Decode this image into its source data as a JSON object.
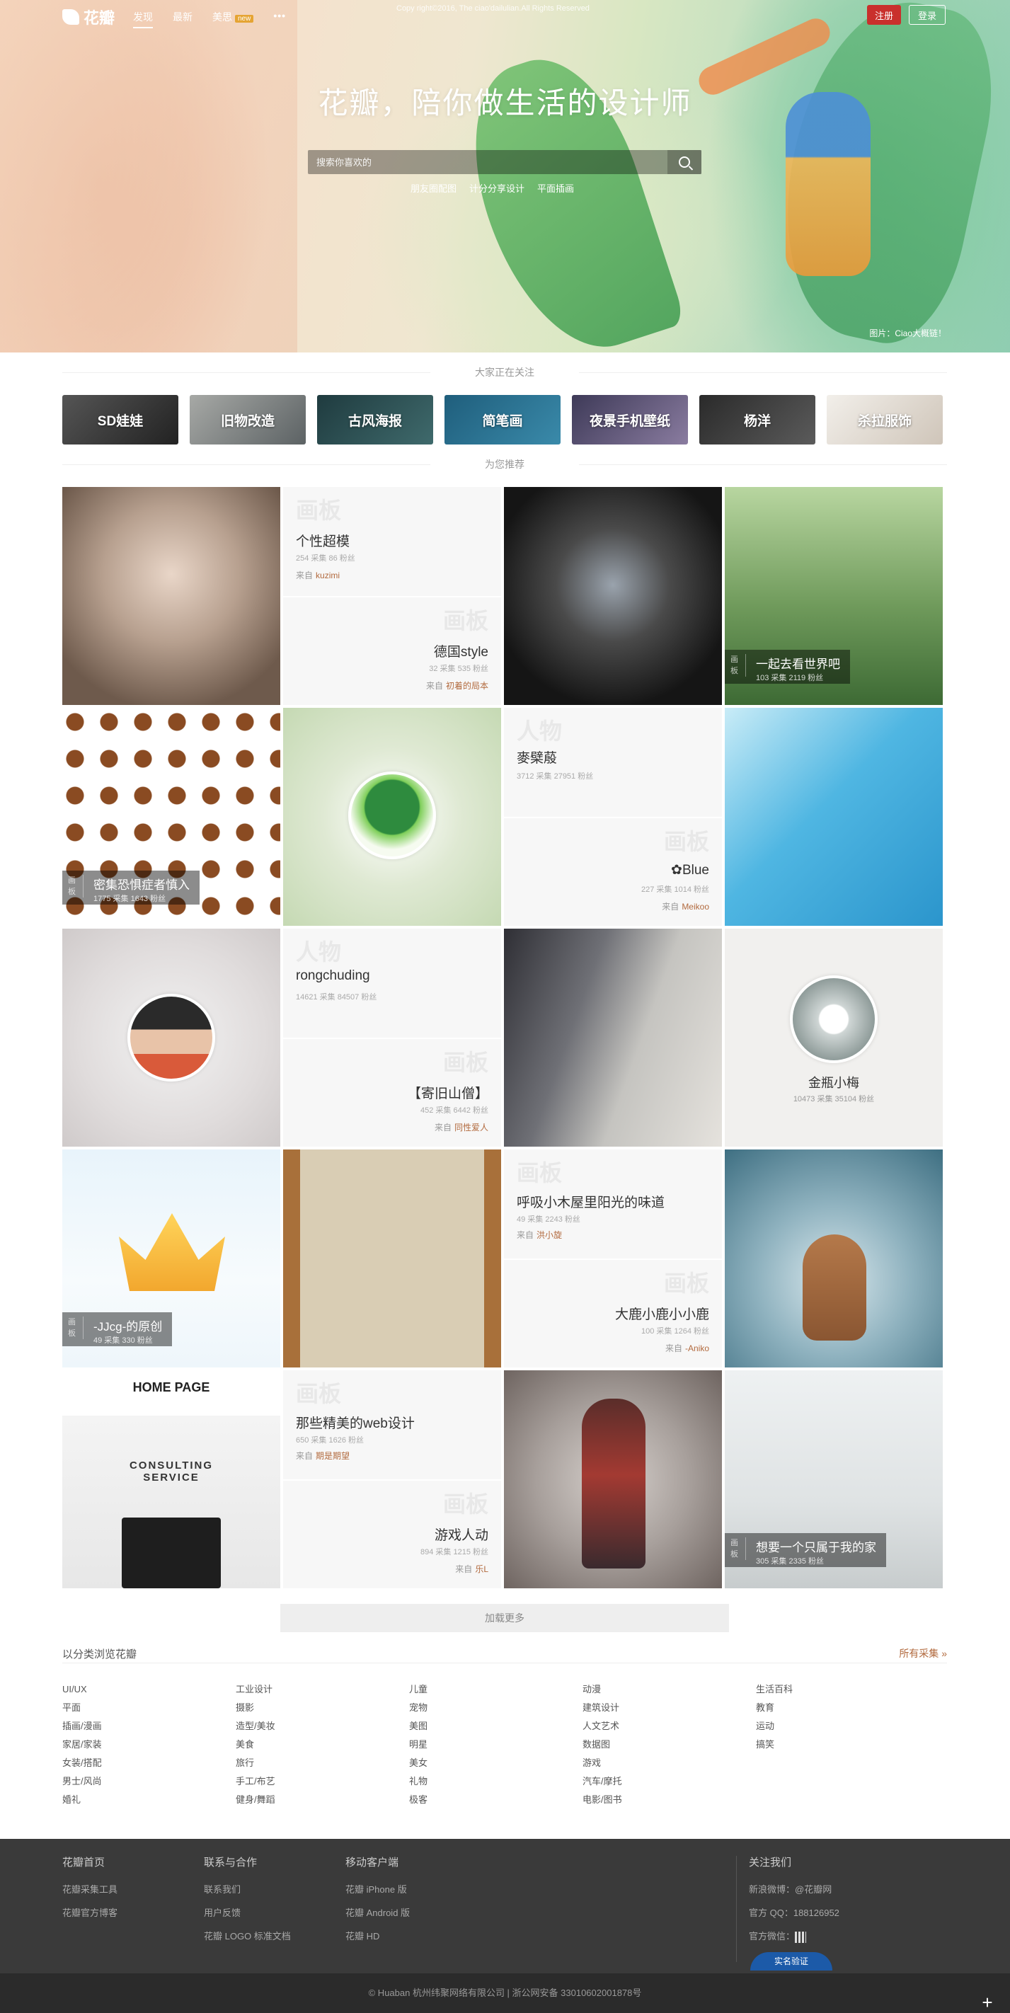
{
  "header": {
    "logo_text": "花瓣",
    "nav": [
      {
        "label": "发现",
        "active": true
      },
      {
        "label": "最新",
        "active": false
      },
      {
        "label": "美思",
        "badge": "new"
      }
    ],
    "more_label": "•••",
    "copyright": "Copy right©2016, The ciao'dailulian.All Rights Reserved",
    "register_label": "注册",
    "login_label": "登录"
  },
  "hero": {
    "title": "花瓣，陪你做生活的设计师",
    "search_placeholder": "搜索你喜欢的",
    "hot_words": [
      "朋友圈配图",
      "计分分享设计",
      "平面插画"
    ],
    "credit": "图片：Ciao大概链！"
  },
  "sections": {
    "following_title": "大家正在关注",
    "recommend_title": "为您推荐"
  },
  "following": [
    {
      "label": "SD娃娃",
      "bg": "#3a3a3a"
    },
    {
      "label": "旧物改造",
      "bg": "#8a8f91"
    },
    {
      "label": "古风海报",
      "bg": "#2d4a4c"
    },
    {
      "label": "简笔画",
      "bg": "#2e6f8a"
    },
    {
      "label": "夜景手机壁纸",
      "bg": "#5a5470"
    },
    {
      "label": "杨洋",
      "bg": "#3b3b3b"
    },
    {
      "label": "杀拉服饰",
      "bg": "#e5e1dc"
    }
  ],
  "boards": {
    "b1": {
      "bg_word": "画板",
      "title": "个性超模",
      "meta": "254 采集  86 粉丝",
      "from": "来自",
      "user": "kuzimi"
    },
    "b2": {
      "bg_word": "画板",
      "title": "德国style",
      "meta": "32 采集  535 粉丝",
      "from": "来自",
      "user": "初着的局本"
    },
    "b3": {
      "bg_word": "人物",
      "title": "麥檗蒑",
      "meta": "3712 采集  27951 粉丝"
    },
    "b4": {
      "bg_word": "画板",
      "title": "✿Blue",
      "meta": "227 采集  1014 粉丝",
      "from": "来自",
      "user": "Meikoo"
    },
    "b5": {
      "bg_word": "人物",
      "title": "rongchuding",
      "meta": "14621 采集  84507 粉丝"
    },
    "b6": {
      "bg_word": "画板",
      "title": "【寄旧山僧】",
      "meta": "452 采集  6442 粉丝",
      "from": "来自",
      "user": "同性爱人"
    },
    "b7": {
      "bg_word": "画板",
      "title": "呼吸小木屋里阳光的味道",
      "meta": "49 采集  2243 粉丝",
      "from": "来自",
      "user": "洪小旋"
    },
    "b8": {
      "bg_word": "画板",
      "title": "大鹿小鹿小小鹿",
      "meta": "100 采集  1264 粉丝",
      "from": "来自",
      "user": "-Aniko"
    },
    "b9": {
      "bg_word": "画板",
      "title": "那些精美的web设计",
      "meta": "650 采集  1626 粉丝",
      "from": "来自",
      "user": "期是期望"
    },
    "b10": {
      "bg_word": "画板",
      "title": "游戏人动",
      "meta": "894 采集  1215 粉丝",
      "from": "来自",
      "user": "乐L"
    }
  },
  "overlays": {
    "o1": {
      "side": "画板",
      "title": "一起去看世界吧",
      "meta": "103 采集  2119 粉丝"
    },
    "o2": {
      "side": "画板",
      "title": "密集恐惧症者慎入",
      "meta": "1775 采集  1643 粉丝"
    },
    "o3": {
      "side": "画板",
      "title": "-JJcg-的原创",
      "meta": "49 采集  330 粉丝"
    },
    "o4": {
      "side": "画板",
      "title": "想要一个只属于我的家",
      "meta": "305 采集  2335 粉丝"
    }
  },
  "persons": {
    "p1": {
      "name": "金瓶小梅",
      "meta": "10473 采集  35104 粉丝"
    }
  },
  "web_card": {
    "top": "HOME PAGE",
    "headline": "CONSULTING SERVICE"
  },
  "load_more": "加载更多",
  "categories": {
    "title": "以分类浏览花瓣",
    "all_link": "所有采集 »",
    "columns": [
      [
        "UI/UX",
        "平面",
        "插画/漫画",
        "家居/家装",
        "女装/搭配",
        "男士/风尚",
        "婚礼"
      ],
      [
        "工业设计",
        "摄影",
        "造型/美妆",
        "美食",
        "旅行",
        "手工/布艺",
        "健身/舞蹈"
      ],
      [
        "儿童",
        "宠物",
        "美图",
        "明星",
        "美女",
        "礼物",
        "极客"
      ],
      [
        "动漫",
        "建筑设计",
        "人文艺术",
        "数据图",
        "游戏",
        "汽车/摩托",
        "电影/图书"
      ],
      [
        "生活百科",
        "教育",
        "运动",
        "搞笑"
      ]
    ]
  },
  "footer": {
    "col1": {
      "title": "花瓣首页",
      "links": [
        "花瓣采集工具",
        "花瓣官方博客"
      ]
    },
    "col2": {
      "title": "联系与合作",
      "links": [
        "联系我们",
        "用户反馈",
        "花瓣 LOGO 标准文档"
      ]
    },
    "col3": {
      "title": "移动客户端",
      "links": [
        "花瓣 iPhone 版",
        "花瓣 Android 版",
        "花瓣 HD"
      ]
    },
    "col4": {
      "title": "关注我们",
      "lines": [
        "新浪微博：@花瓣网",
        "官方 QQ：188126952",
        "官方微信："
      ]
    },
    "verified_badge": "实名验证",
    "bottom": "© Huaban 杭州纬聚网络有限公司  |  浙公网安备 33010602001878号",
    "plus": "+"
  },
  "colors": {
    "accent": "#b26a3e",
    "register": "#c9302c",
    "footer_bg": "#3a3a3a"
  }
}
